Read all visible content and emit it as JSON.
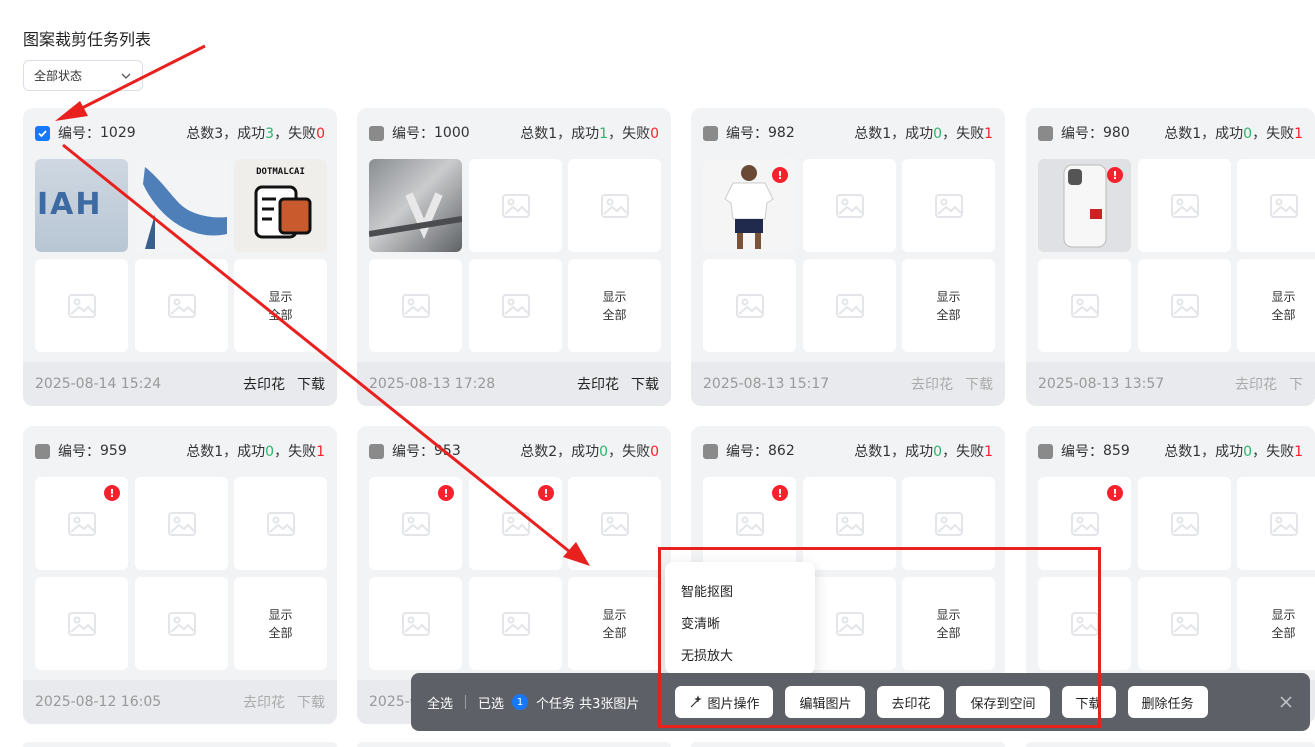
{
  "page": {
    "title": "图案裁剪任务列表"
  },
  "filter": {
    "status_label": "全部状态"
  },
  "labels": {
    "number_prefix": "编号：",
    "show_all_line1": "显示",
    "show_all_line2": "全部"
  },
  "cards": [
    {
      "id": "1029",
      "total": "总数3，成功",
      "success": "3",
      "fail_prefix": "，失败",
      "fail": "0",
      "date": "2025-08-14 15:24",
      "action1": "去印花",
      "action2": "下载"
    },
    {
      "id": "1000",
      "total": "总数1，成功",
      "success": "1",
      "fail_prefix": "，失败",
      "fail": "0",
      "date": "2025-08-13 17:28",
      "action1": "去印花",
      "action2": "下载"
    },
    {
      "id": "982",
      "total": "总数1，成功",
      "success": "0",
      "fail_prefix": "，失败",
      "fail": "1",
      "date": "2025-08-13 15:17",
      "action1": "去印花",
      "action2": "下载"
    },
    {
      "id": "980",
      "total": "总数1，成功",
      "success": "0",
      "fail_prefix": "，失败",
      "fail": "1",
      "date": "2025-08-13 13:57",
      "action1": "去印花",
      "action2": "下"
    },
    {
      "id": "959",
      "total": "总数1，成功",
      "success": "0",
      "fail_prefix": "，失败",
      "fail": "1",
      "date": "2025-08-12 16:05",
      "action1": "去印花",
      "action2": "下载"
    },
    {
      "id": "953",
      "total": "总数2，成功",
      "success": "0",
      "fail_prefix": "，失败",
      "fail": "0",
      "date": "2025-0",
      "action1": "",
      "action2": ""
    },
    {
      "id": "862",
      "total": "总数1，成功",
      "success": "0",
      "fail_prefix": "，失败",
      "fail": "1",
      "date": "",
      "action1": "",
      "action2": ""
    },
    {
      "id": "859",
      "total": "总数1，成功",
      "success": "0",
      "fail_prefix": "，失败",
      "fail": "1",
      "date": "",
      "action1": "",
      "action2": ""
    }
  ],
  "thumbnails": {
    "hoodie_text": "IAH",
    "sticker_text": "DOTMALCAI"
  },
  "menu": {
    "items": [
      "智能抠图",
      "变清晰",
      "无损放大"
    ]
  },
  "action_bar": {
    "select_all": "全选",
    "selected": "已选",
    "selected_count": "1",
    "summary": "个任务 共3张图片",
    "buttons": [
      "图片操作",
      "编辑图片",
      "去印花",
      "保存到空间",
      "下载",
      "删除任务"
    ]
  },
  "colors": {
    "primary": "#1677ff",
    "success": "#2fb36a",
    "danger": "#f5222d",
    "annotation": "#e8201e"
  }
}
